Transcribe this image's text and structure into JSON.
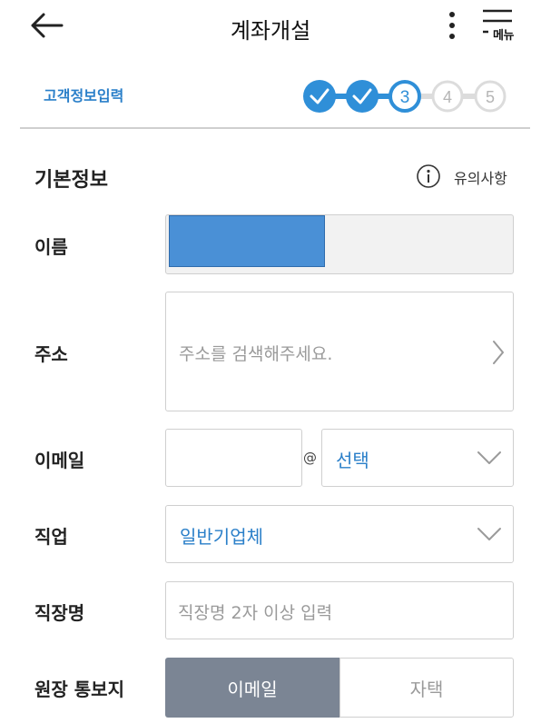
{
  "header": {
    "title": "계좌개설",
    "menu_label": "메뉴"
  },
  "steps": {
    "title": "고객정보입력",
    "current": 3,
    "items": [
      "1",
      "2",
      "3",
      "4",
      "5"
    ],
    "completed_color": "#2f8fd8",
    "pending_color": "#d9d9d9"
  },
  "section": {
    "title": "기본정보",
    "notice_label": "유의사항"
  },
  "form": {
    "name": {
      "label": "이름",
      "value": ""
    },
    "address": {
      "label": "주소",
      "placeholder": "주소를 검색해주세요."
    },
    "email": {
      "label": "이메일",
      "at": "@",
      "domain_value": "선택"
    },
    "job": {
      "label": "직업",
      "value": "일반기업체"
    },
    "workplace": {
      "label": "직장명",
      "placeholder": "직장명 2자 이상 입력"
    },
    "statement": {
      "label": "원장 통보지",
      "options": [
        "이메일",
        "자택"
      ],
      "selected": "이메일"
    }
  },
  "colors": {
    "accent": "#2a7fc9",
    "toggle_selected": "#7b8594"
  }
}
